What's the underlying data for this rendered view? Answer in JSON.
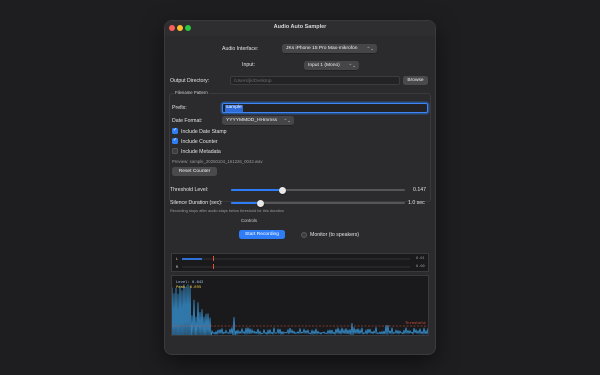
{
  "window": {
    "title": "Audio Auto Sampler"
  },
  "audio_interface": {
    "label": "Audio Interface:",
    "value": "JKs iPhone 15 Pro Max-mikrofon"
  },
  "input": {
    "label": "Input:",
    "value": "Input 1 (Mono)"
  },
  "output_directory": {
    "label": "Output Directory:",
    "placeholder": "/Users/jk/Desktop",
    "browse_label": "Browse"
  },
  "filename_pattern": {
    "section_label": "Filename Pattern",
    "prefix_label": "Prefix:",
    "prefix_value": "sample",
    "date_format_label": "Date Format:",
    "date_format_value": "YYYYMMDD_HHmmss",
    "include_date_stamp": {
      "label": "Include Date Stamp",
      "checked": true
    },
    "include_counter": {
      "label": "Include Counter",
      "checked": true
    },
    "include_metadata": {
      "label": "Include Metadata",
      "checked": false
    },
    "preview": "Preview: sample_20250104_161226_0042.wav",
    "reset_label": "Reset Counter"
  },
  "threshold": {
    "label": "Threshold Level:",
    "value_text": "0.147",
    "fraction": 0.147
  },
  "silence": {
    "label": "Silence Duration (sec):",
    "value_text": "1.0 sec",
    "fraction": 0.17,
    "hint": "Recording stops after audio stays below threshold for this duration"
  },
  "controls": {
    "section_label": "Controls",
    "start_label": "Start Recording",
    "monitor_label": "Monitor (to speakers)",
    "monitor_checked": false
  },
  "meters": {
    "left": {
      "letter": "L",
      "value_text": "0.01",
      "level": 0.04
    },
    "right": {
      "letter": "R",
      "value_text": "0.00",
      "level": 0.0
    }
  },
  "waveform": {
    "level_text": "Level: 0.042",
    "peak_text": "Peak: 0.695",
    "threshold_text": "Threshold",
    "threshold_level": 0.147
  },
  "colors": {
    "accent": "#2f7df6",
    "threshold": "#e0503a",
    "wave": "#3aa0e8",
    "peak": "#f2d34a"
  }
}
